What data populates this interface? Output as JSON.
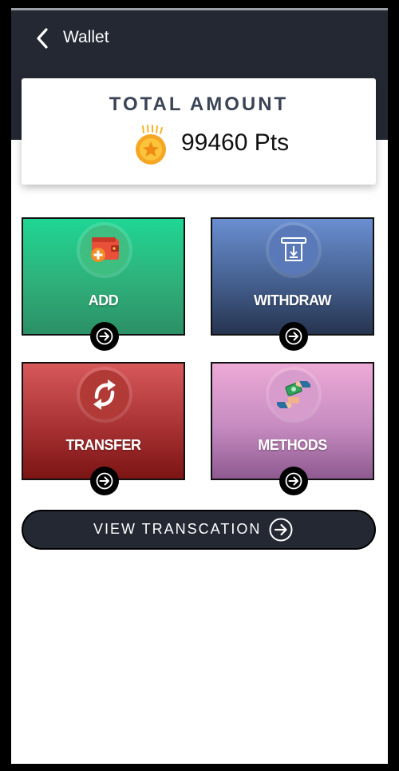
{
  "header": {
    "title": "Wallet"
  },
  "summary": {
    "label": "TOTAL AMOUNT",
    "amount": "99460 Pts"
  },
  "actions": [
    {
      "label": "ADD"
    },
    {
      "label": "WITHDRAW"
    },
    {
      "label": "TRANSFER"
    },
    {
      "label": "METHODS"
    }
  ],
  "view_button": {
    "label": "VIEW TRANSCATION"
  },
  "colors": {
    "header_bg": "#232833",
    "add": "#2fb07a",
    "withdraw": "#45608f",
    "transfer": "#a83234",
    "methods": "#c68bc0",
    "coin": "#f5b323"
  },
  "icons": {
    "back": "chevron-left-icon",
    "coin": "coin-star-icon",
    "add": "wallet-plus-icon",
    "withdraw": "atm-withdraw-icon",
    "transfer": "transfer-arrows-icon",
    "methods": "money-hands-icon",
    "tile_arrow": "arrow-right-circle-icon"
  }
}
